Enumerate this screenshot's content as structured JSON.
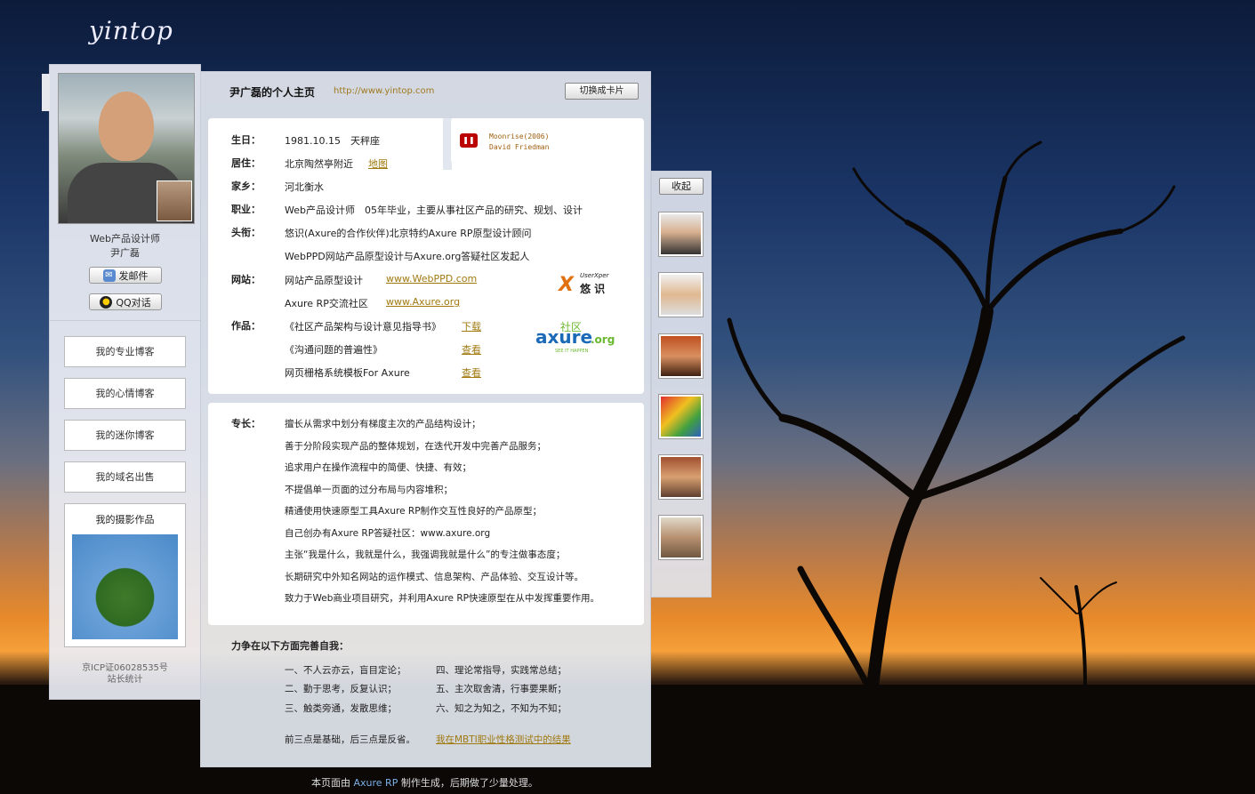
{
  "site": {
    "logo": "yintop"
  },
  "profile": {
    "title": "尹广磊的个人主页",
    "url": "http://www.yintop.com",
    "switch_label": "切换成卡片",
    "job_title": "Web产品设计师",
    "name": "尹广磊",
    "mail_button": "发邮件",
    "qq_button": "QQ对话"
  },
  "nav": [
    {
      "label": "我的专业博客"
    },
    {
      "label": "我的心情博客"
    },
    {
      "label": "我的迷你博客"
    },
    {
      "label": "我的域名出售"
    }
  ],
  "photo_works": {
    "label": "我的摄影作品"
  },
  "footer_left": {
    "icp": "京ICP证06028535号",
    "stats": "站长统计"
  },
  "music": {
    "line1": "Moonrise(2006)",
    "line2": "David Friedman",
    "play_icon": "pause-icon"
  },
  "info": {
    "birthday": {
      "label": "生日：",
      "value": "1981.10.15　天秤座"
    },
    "residence": {
      "label": "居住：",
      "value": "北京陶然亭附近",
      "link": "地图"
    },
    "hometown": {
      "label": "家乡：",
      "value": "河北衡水"
    },
    "job": {
      "label": "职业：",
      "value": "Web产品设计师　05年毕业，主要从事社区产品的研究、规划、设计"
    },
    "title": {
      "label": "头衔：",
      "line1": "悠识(Axure的合作伙伴)北京特约Axure RP原型设计顾问",
      "line2": "WebPPD网站产品原型设计与Axure.org答疑社区发起人"
    },
    "website": {
      "label": "网站：",
      "items": [
        {
          "name": "网站产品原型设计",
          "link": "www.WebPPD.com"
        },
        {
          "name": "Axure RP交流社区",
          "link": "www.Axure.org"
        }
      ]
    },
    "works": {
      "label": "作品：",
      "items": [
        {
          "name": "《社区产品架构与设计意见指导书》",
          "link": "下载"
        },
        {
          "name": "《沟通问题的普遍性》",
          "link": "查看"
        },
        {
          "name": "网页栅格系统模板For Axure",
          "link": "查看"
        }
      ]
    }
  },
  "brands": {
    "ux_small": "UserXper",
    "ux_cn": "悠 识",
    "axure_text": "axure",
    "axure_org": ".org",
    "axure_cn": "社区",
    "axure_tag": "SEE IT HAPPEN"
  },
  "specialty": {
    "label": "专长：",
    "lines": [
      "擅长从需求中划分有梯度主次的产品结构设计；",
      "善于分阶段实现产品的整体规划，在迭代开发中完善产品服务；",
      "追求用户在操作流程中的简便、快捷、有效；",
      "不提倡单一页面的过分布局与内容堆积；",
      "精通使用快速原型工具Axure RP制作交互性良好的产品原型；",
      "自己创办有Axure RP答疑社区：www.axure.org",
      "主张“我是什么，我就是什么，我强调我就是什么”的专注做事态度；",
      "长期研究中外知名网站的运作模式、信息架构、产品体验、交互设计等。",
      "致力于Web商业项目研究，并利用Axure RP快速原型在从中发挥重要作用。"
    ]
  },
  "self_improve": {
    "heading": "力争在以下方面完善自我：",
    "left": [
      "一、不人云亦云，盲目定论；",
      "二、勤于思考，反复认识；",
      "三、触类旁通，发散思维；"
    ],
    "right": [
      "四、理论常指导，实践常总结；",
      "五、主次取舍清，行事要果断；",
      "六、知之为知之，不知为不知；"
    ],
    "note": "前三点是基础，后三点是反省。",
    "note_link": "我在MBTI职业性格测试中的结果"
  },
  "page_footer": {
    "pre": "本页面由",
    "brand": "Axure RP",
    "post": "制作生成，后期做了少量处理。"
  },
  "right_panel": {
    "collapse": "收起"
  },
  "colors": {
    "link": "#a07a10",
    "url": "#a07a20",
    "axure_blue": "#1a6ab8",
    "axure_green": "#6ab830"
  }
}
